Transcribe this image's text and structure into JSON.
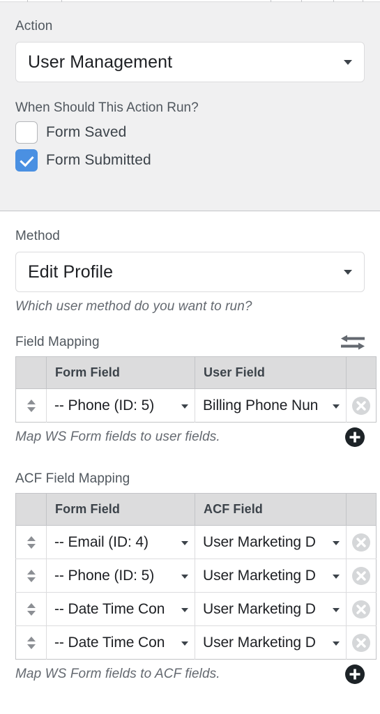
{
  "action_section": {
    "label": "Action",
    "select_value": "User Management",
    "run_when_label": "When Should This Action Run?",
    "checkboxes": [
      {
        "label": "Form Saved",
        "checked": false
      },
      {
        "label": "Form Submitted",
        "checked": true
      }
    ]
  },
  "method_section": {
    "label": "Method",
    "select_value": "Edit Profile",
    "help_text": "Which user method do you want to run?"
  },
  "field_mapping": {
    "title": "Field Mapping",
    "swap_icon": "swap-arrows-icon",
    "columns": {
      "handle": "",
      "form_field": "Form Field",
      "target_field": "User Field",
      "delete": ""
    },
    "rows": [
      {
        "form_field": "-- Phone (ID: 5)",
        "target_field": "Billing Phone Nun"
      }
    ],
    "footer_text": "Map WS Form fields to user fields.",
    "add_icon": "plus-circle-icon"
  },
  "acf_field_mapping": {
    "title": "ACF Field Mapping",
    "columns": {
      "handle": "",
      "form_field": "Form Field",
      "target_field": "ACF Field",
      "delete": ""
    },
    "rows": [
      {
        "form_field": "-- Email (ID: 4)",
        "target_field": "User Marketing D"
      },
      {
        "form_field": "-- Phone (ID: 5)",
        "target_field": "User Marketing D"
      },
      {
        "form_field": "-- Date Time Con",
        "target_field": "User Marketing D"
      },
      {
        "form_field": "-- Date Time Con",
        "target_field": "User Marketing D"
      }
    ],
    "footer_text": "Map WS Form fields to ACF fields.",
    "add_icon": "plus-circle-icon"
  },
  "colors": {
    "panel_gray": "#f0f0f1",
    "checkbox_accent": "#4a90e2",
    "table_header": "#dcdcdd",
    "border": "#c3c4c7",
    "text_muted": "#646970"
  }
}
